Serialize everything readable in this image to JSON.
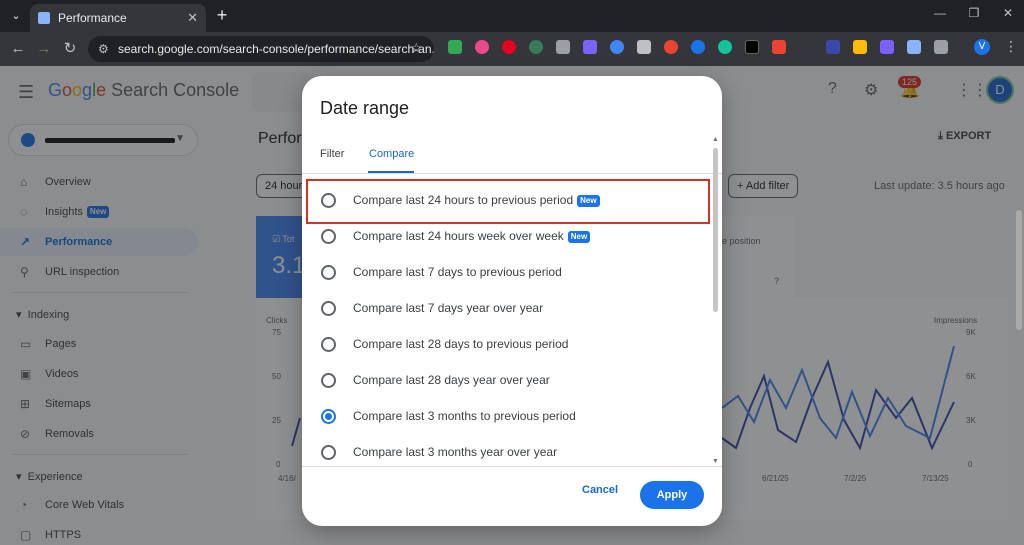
{
  "browser": {
    "tab_title": "Performance",
    "url": "search.google.com/search-console/performance/search-an...",
    "profile_initial": "V"
  },
  "header": {
    "logo_word": [
      "G",
      "o",
      "o",
      "g",
      "l",
      "e"
    ],
    "logo_product": "Search Console",
    "notification_count": "125",
    "avatar_initial": "D"
  },
  "sidebar": {
    "items": [
      {
        "label": "Overview"
      },
      {
        "label": "Insights",
        "badge": "New"
      },
      {
        "label": "Performance"
      },
      {
        "label": "URL inspection"
      }
    ],
    "indexing_title": "Indexing",
    "indexing_items": [
      "Pages",
      "Videos",
      "Sitemaps",
      "Removals"
    ],
    "experience_title": "Experience",
    "experience_items": [
      "Core Web Vitals",
      "HTTPS"
    ]
  },
  "main": {
    "title": "Perfor",
    "export_label": "EXPORT",
    "range_chip": "24 hour",
    "add_filter": "Add filter",
    "last_update": "Last update: 3.5 hours ago",
    "card_blue_label": "Tot",
    "card_blue_value": "3.1",
    "card_white_label": "e position",
    "chart": {
      "left_label": "Clicks",
      "right_label": "Impressions",
      "left_ticks": [
        "75",
        "50",
        "25",
        "0"
      ],
      "right_ticks": [
        "9K",
        "6K",
        "3K",
        "0"
      ],
      "x_ticks": [
        "4/16/",
        "6/21/25",
        "7/2/25",
        "7/13/25"
      ]
    }
  },
  "dialog": {
    "title": "Date range",
    "tabs": [
      "Filter",
      "Compare"
    ],
    "options": [
      {
        "label": "Compare last 24 hours to previous period",
        "badge": "New"
      },
      {
        "label": "Compare last 24 hours week over week",
        "badge": "New"
      },
      {
        "label": "Compare last 7 days to previous period"
      },
      {
        "label": "Compare last 7 days year over year"
      },
      {
        "label": "Compare last 28 days to previous period"
      },
      {
        "label": "Compare last 28 days year over year"
      },
      {
        "label": "Compare last 3 months to previous period",
        "selected": true
      },
      {
        "label": "Compare last 3 months year over year"
      }
    ],
    "cancel_label": "Cancel",
    "apply_label": "Apply"
  },
  "colors": {
    "accent": "#1a73e8",
    "highlight": "#d93025"
  }
}
